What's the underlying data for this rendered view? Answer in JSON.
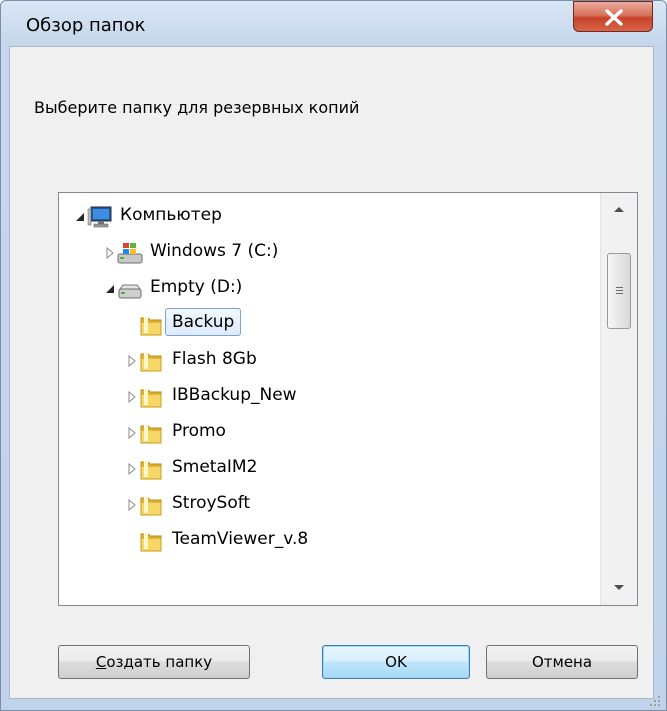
{
  "window": {
    "title": "Обзор папок",
    "close_icon": "close-icon"
  },
  "dialog": {
    "prompt": "Выберите папку для резервных копий"
  },
  "tree": {
    "root": {
      "label": "Компьютер",
      "icon": "computer-icon",
      "expanded": true
    },
    "items": [
      {
        "label": "Windows 7 (C:)",
        "icon": "windows-drive-icon",
        "expander": "collapsed"
      },
      {
        "label": "Empty (D:)",
        "icon": "hard-drive-icon",
        "expander": "expanded"
      },
      {
        "label": "Backup",
        "icon": "folder-icon",
        "expander": "none",
        "selected": true
      },
      {
        "label": "Flash 8Gb",
        "icon": "folder-icon",
        "expander": "collapsed"
      },
      {
        "label": "IBBackup_New",
        "icon": "folder-icon",
        "expander": "collapsed"
      },
      {
        "label": "Promo",
        "icon": "folder-icon",
        "expander": "collapsed"
      },
      {
        "label": "SmetaIM2",
        "icon": "folder-icon",
        "expander": "collapsed"
      },
      {
        "label": "StroySoft",
        "icon": "folder-icon",
        "expander": "collapsed"
      },
      {
        "label": "TeamViewer_v.8",
        "icon": "folder-icon",
        "expander": "none"
      }
    ]
  },
  "buttons": {
    "new_folder_prefix": "С",
    "new_folder_rest": "оздать папку",
    "ok": "OK",
    "cancel": "Отмена"
  },
  "colors": {
    "selection_border": "#7da2ce",
    "close_button": "#c7432b",
    "default_button_border": "#3c7fb1"
  }
}
